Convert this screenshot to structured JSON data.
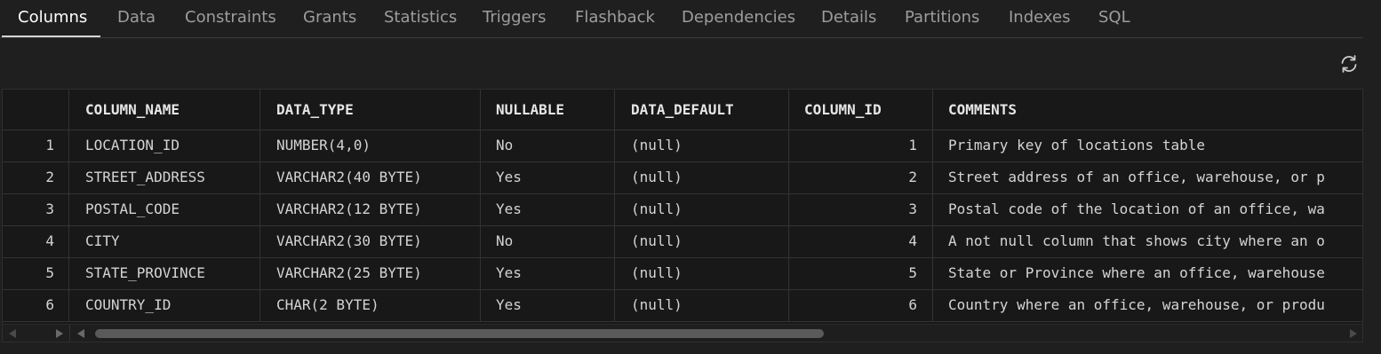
{
  "tabs": [
    {
      "label": "Columns",
      "active": true
    },
    {
      "label": "Data"
    },
    {
      "label": "Constraints"
    },
    {
      "label": "Grants"
    },
    {
      "label": "Statistics"
    },
    {
      "label": "Triggers"
    },
    {
      "label": "Flashback"
    },
    {
      "label": "Dependencies"
    },
    {
      "label": "Details"
    },
    {
      "label": "Partitions"
    },
    {
      "label": "Indexes"
    },
    {
      "label": "SQL"
    }
  ],
  "toolbar": {
    "refresh_icon": "refresh-icon"
  },
  "table": {
    "columns": [
      "",
      "COLUMN_NAME",
      "DATA_TYPE",
      "NULLABLE",
      "DATA_DEFAULT",
      "COLUMN_ID",
      "COMMENTS"
    ],
    "rows": [
      [
        "1",
        "LOCATION_ID",
        "NUMBER(4,0)",
        "No",
        "(null)",
        "1",
        "Primary key of locations table"
      ],
      [
        "2",
        "STREET_ADDRESS",
        "VARCHAR2(40 BYTE)",
        "Yes",
        "(null)",
        "2",
        "Street address of an office, warehouse, or p"
      ],
      [
        "3",
        "POSTAL_CODE",
        "VARCHAR2(12 BYTE)",
        "Yes",
        "(null)",
        "3",
        "Postal code of the location of an office, wa"
      ],
      [
        "4",
        "CITY",
        "VARCHAR2(30 BYTE)",
        "No",
        "(null)",
        "4",
        "A not null column that shows city where an o"
      ],
      [
        "5",
        "STATE_PROVINCE",
        "VARCHAR2(25 BYTE)",
        "Yes",
        "(null)",
        "5",
        "State or Province where an office, warehouse"
      ],
      [
        "6",
        "COUNTRY_ID",
        "CHAR(2 BYTE)",
        "Yes",
        "(null)",
        "6",
        "Country where an office, warehouse, or produ"
      ]
    ]
  },
  "colors": {
    "background": "#1f1f1f",
    "grid_background": "#181818",
    "active_tab": "#ffffff",
    "inactive_tab": "#9d9d9d"
  }
}
